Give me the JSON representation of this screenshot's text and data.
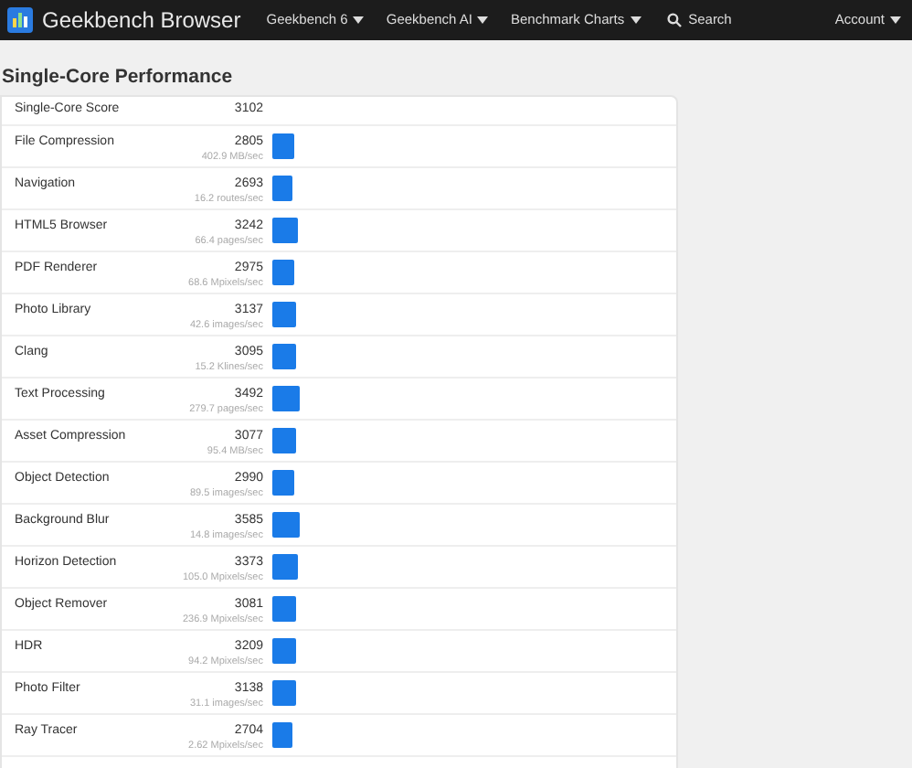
{
  "navbar": {
    "brand": "Geekbench Browser",
    "menus": [
      {
        "label": "Geekbench 6",
        "kind": "dropdown"
      },
      {
        "label": "Geekbench AI",
        "kind": "dropdown"
      },
      {
        "label": "Benchmark Charts",
        "kind": "dropdown"
      },
      {
        "label": "Search",
        "kind": "search"
      }
    ],
    "account": "Account"
  },
  "heading": "Single-Core Performance",
  "score": {
    "label": "Single-Core Score",
    "value": "3102"
  },
  "rows": [
    {
      "name": "File Compression",
      "score": "2805",
      "rate": "402.9 MB/sec"
    },
    {
      "name": "Navigation",
      "score": "2693",
      "rate": "16.2 routes/sec"
    },
    {
      "name": "HTML5 Browser",
      "score": "3242",
      "rate": "66.4 pages/sec"
    },
    {
      "name": "PDF Renderer",
      "score": "2975",
      "rate": "68.6 Mpixels/sec"
    },
    {
      "name": "Photo Library",
      "score": "3137",
      "rate": "42.6 images/sec"
    },
    {
      "name": "Clang",
      "score": "3095",
      "rate": "15.2 Klines/sec"
    },
    {
      "name": "Text Processing",
      "score": "3492",
      "rate": "279.7 pages/sec"
    },
    {
      "name": "Asset Compression",
      "score": "3077",
      "rate": "95.4 MB/sec"
    },
    {
      "name": "Object Detection",
      "score": "2990",
      "rate": "89.5 images/sec"
    },
    {
      "name": "Background Blur",
      "score": "3585",
      "rate": "14.8 images/sec"
    },
    {
      "name": "Horizon Detection",
      "score": "3373",
      "rate": "105.0 Mpixels/sec"
    },
    {
      "name": "Object Remover",
      "score": "3081",
      "rate": "236.9 Mpixels/sec"
    },
    {
      "name": "HDR",
      "score": "3209",
      "rate": "94.2 Mpixels/sec"
    },
    {
      "name": "Photo Filter",
      "score": "3138",
      "rate": "31.1 images/sec"
    },
    {
      "name": "Ray Tracer",
      "score": "2704",
      "rate": "2.62 Mpixels/sec"
    }
  ]
}
